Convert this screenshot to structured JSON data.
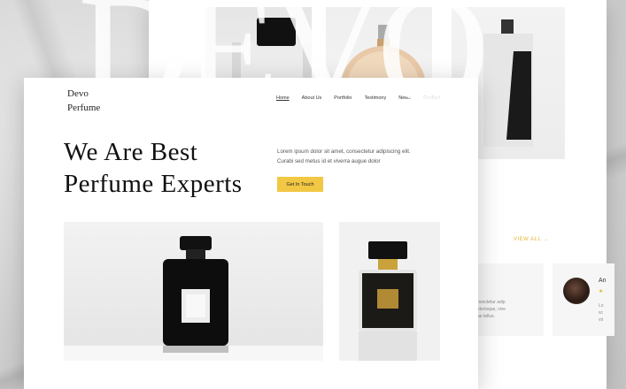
{
  "brand": {
    "logo_text": "Devo\nPerfume",
    "watermark": "DEVO"
  },
  "nav": {
    "items": [
      {
        "label": "Home",
        "active": true
      },
      {
        "label": "About Us",
        "active": false
      },
      {
        "label": "Portfolio",
        "active": false
      },
      {
        "label": "Testimony",
        "active": false
      },
      {
        "label": "News",
        "active": false
      },
      {
        "label": "Contact",
        "active": false
      }
    ]
  },
  "hero": {
    "headline": "We Are Best\nPerfume Experts",
    "intro": "Lorem ipsum dolor sit amet, consectetur adipiscing elit. Curabi sed metus id et viverra augue dolor",
    "cta_label": "Get In Touch",
    "accent_color": "#F2C744"
  },
  "gallery": {
    "view_all_label": "VIEW ALL →"
  },
  "testimonials": {
    "card_text": "consectetur adip\nscelerisque, vive\nvitae tellus.",
    "name": "An",
    "stars": "★",
    "card_text_2": "Lo\nsc\nvit"
  }
}
